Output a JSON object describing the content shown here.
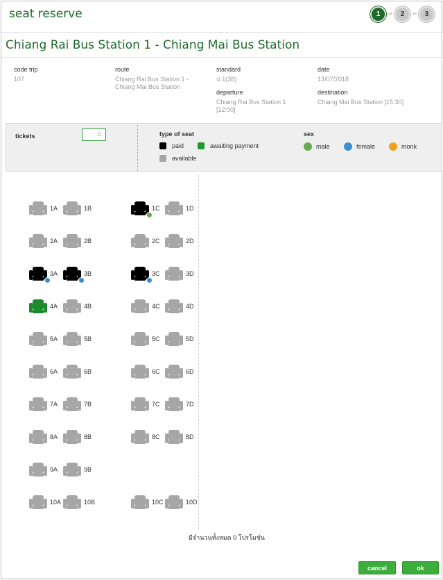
{
  "header": {
    "title": "seat reserve",
    "steps": [
      "1",
      "2",
      "3"
    ],
    "active_step": "1"
  },
  "route_title": "Chiang Rai Bus Station 1 - Chiang Mai Bus Station",
  "trip_info": {
    "code_trip": {
      "label": "code trip",
      "value": "107"
    },
    "route": {
      "label": "route",
      "value": "Chiang Rai Bus Station 1 - Chiang Mai Bus Station"
    },
    "standard": {
      "label": "standard",
      "value": "ป.1(38)"
    },
    "date": {
      "label": "date",
      "value": "13/07/2018"
    },
    "departure": {
      "label": "departure",
      "value": "Chiang Rai Bus Station 1 [12:00]"
    },
    "destination": {
      "label": "destination",
      "value": "Chiang Mai Bus Station [15:30]"
    }
  },
  "tickets": {
    "label": "tickets",
    "value": "0"
  },
  "legend": {
    "type_title": "type of seat",
    "paid": "paid",
    "awaiting": "awaiting payment",
    "available": "available",
    "sex_title": "sex",
    "male": "male",
    "female": "female",
    "monk": "monk"
  },
  "colors": {
    "brand": "#1e6b2a",
    "button": "#3cae3c",
    "paid": "#000000",
    "awaiting": "#1e8a2e",
    "available": "#a6a6a6"
  },
  "seats": [
    {
      "id": "1A",
      "status": "available"
    },
    {
      "id": "1B",
      "status": "available"
    },
    {
      "id": "1C",
      "status": "paid",
      "sex": "male"
    },
    {
      "id": "1D",
      "status": "available"
    },
    {
      "id": "2A",
      "status": "available"
    },
    {
      "id": "2B",
      "status": "available"
    },
    {
      "id": "2C",
      "status": "available"
    },
    {
      "id": "2D",
      "status": "available"
    },
    {
      "id": "3A",
      "status": "paid",
      "sex": "female"
    },
    {
      "id": "3B",
      "status": "paid",
      "sex": "female"
    },
    {
      "id": "3C",
      "status": "paid",
      "sex": "female"
    },
    {
      "id": "3D",
      "status": "available"
    },
    {
      "id": "4A",
      "status": "awaiting"
    },
    {
      "id": "4B",
      "status": "available"
    },
    {
      "id": "4C",
      "status": "available"
    },
    {
      "id": "4D",
      "status": "available"
    },
    {
      "id": "5A",
      "status": "available"
    },
    {
      "id": "5B",
      "status": "available"
    },
    {
      "id": "5C",
      "status": "available"
    },
    {
      "id": "5D",
      "status": "available"
    },
    {
      "id": "6A",
      "status": "available"
    },
    {
      "id": "6B",
      "status": "available"
    },
    {
      "id": "6C",
      "status": "available"
    },
    {
      "id": "6D",
      "status": "available"
    },
    {
      "id": "7A",
      "status": "available"
    },
    {
      "id": "7B",
      "status": "available"
    },
    {
      "id": "7C",
      "status": "available"
    },
    {
      "id": "7D",
      "status": "available"
    },
    {
      "id": "8A",
      "status": "available"
    },
    {
      "id": "8B",
      "status": "available"
    },
    {
      "id": "8C",
      "status": "available"
    },
    {
      "id": "8D",
      "status": "available"
    },
    {
      "id": "9A",
      "status": "available"
    },
    {
      "id": "9B",
      "status": "available"
    },
    {
      "id": "10A",
      "status": "available"
    },
    {
      "id": "10B",
      "status": "available"
    },
    {
      "id": "10C",
      "status": "available"
    },
    {
      "id": "10D",
      "status": "available"
    }
  ],
  "promo_text": "มีจำนวนทั้งหมด 0 โปรโมชั่น",
  "buttons": {
    "cancel": "cancel",
    "ok": "ok"
  }
}
